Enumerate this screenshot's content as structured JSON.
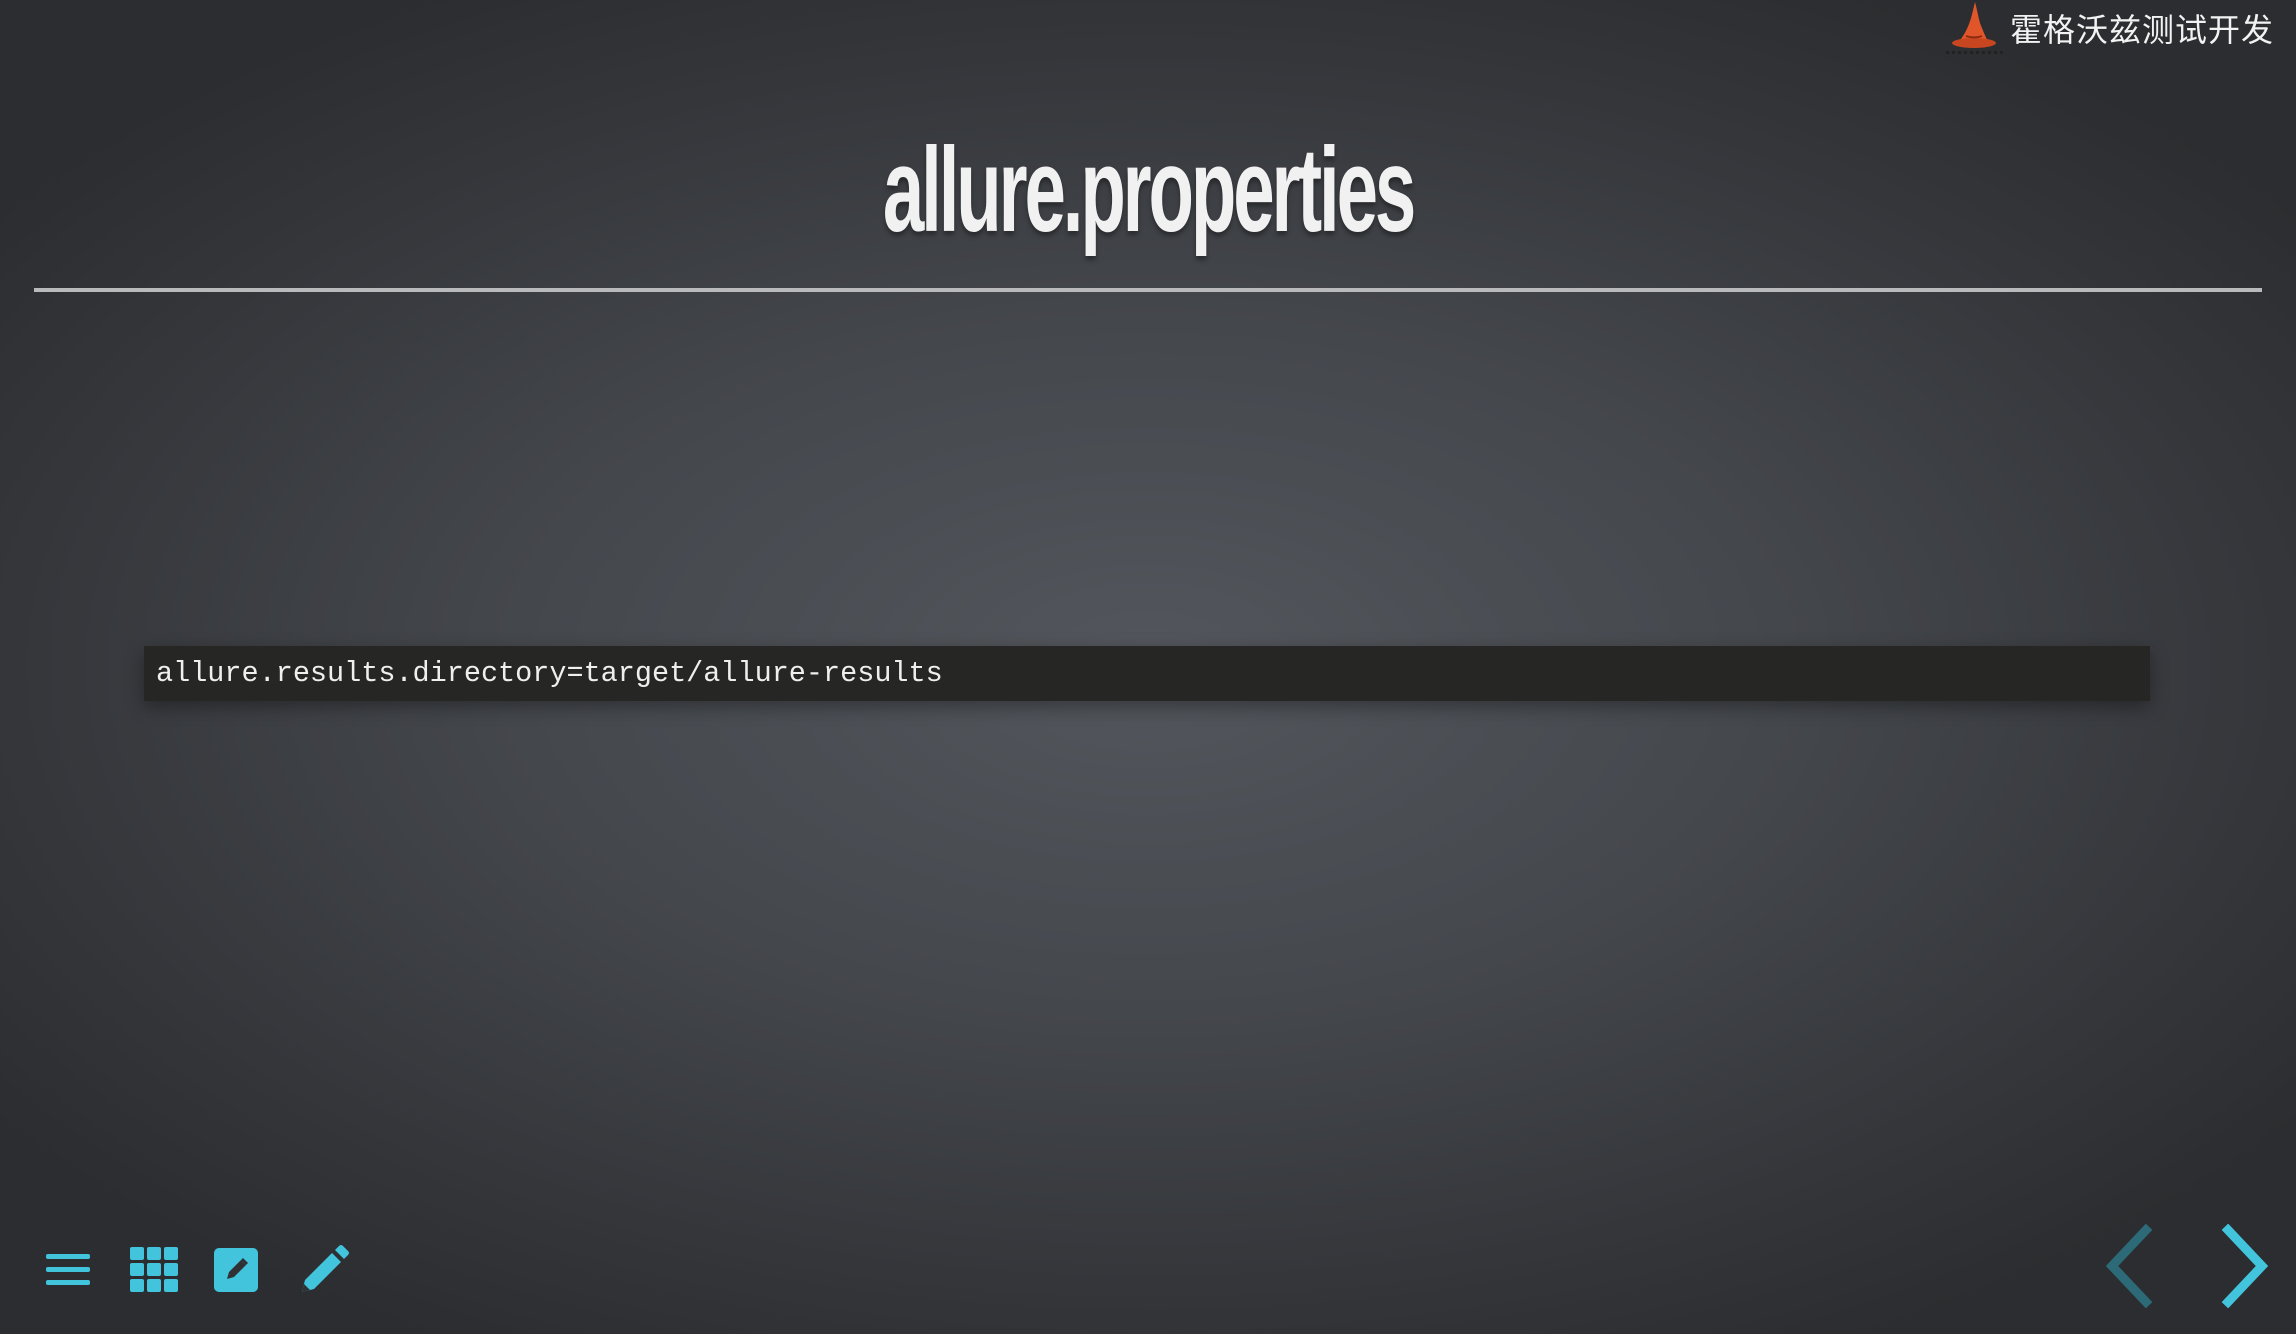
{
  "brand": {
    "name": "霍格沃兹测试开发",
    "logo_icon": "wizard-hat-icon"
  },
  "slide": {
    "title": "allure.properties",
    "code": "allure.results.directory=target/allure-results"
  },
  "toolbar": {
    "items": [
      {
        "icon": "menu-icon"
      },
      {
        "icon": "grid-icon"
      },
      {
        "icon": "edit-square-icon"
      },
      {
        "icon": "pencil-icon"
      }
    ]
  },
  "navigation": {
    "prev_icon": "chevron-left-icon",
    "next_icon": "chevron-right-icon"
  },
  "colors": {
    "accent": "#42c4dc",
    "accent_dim": "#2c6a78",
    "brand_orange": "#e0562a",
    "title": "#f1f1f1",
    "code_bg": "#262624"
  }
}
